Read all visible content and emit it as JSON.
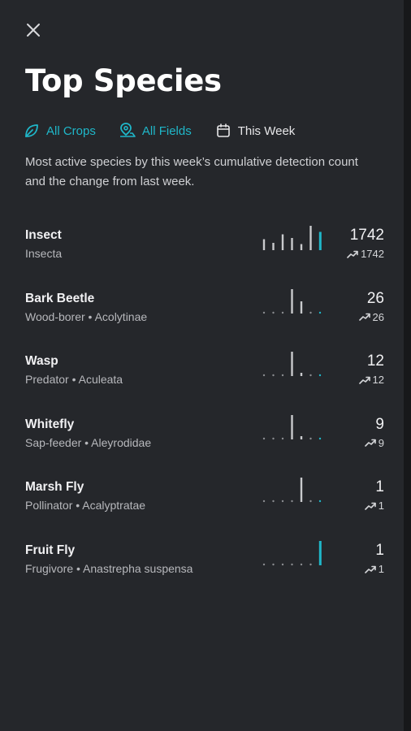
{
  "header": {
    "close_icon": "close-icon",
    "title": "Top Species"
  },
  "filters": [
    {
      "label": "All Crops",
      "icon": "leaf-icon",
      "color": "#1fb7c9"
    },
    {
      "label": "All Fields",
      "icon": "map-pin-icon",
      "color": "#1fb7c9"
    },
    {
      "label": "This Week",
      "icon": "calendar-icon",
      "color": "#e6e6e8"
    }
  ],
  "description": "Most active species by this week’s cumulative detection count and the change from last week.",
  "colors": {
    "accent": "#1fb7c9",
    "bar": "#c9cacd",
    "dot": "#8a8c90",
    "background": "#25272b"
  },
  "species": [
    {
      "name": "Insect",
      "sub": "Insecta",
      "count": "1742",
      "delta": "1742",
      "trend": [
        0.45,
        0.3,
        0.65,
        0.5,
        0.25,
        1.0,
        0.75
      ]
    },
    {
      "name": "Bark Beetle",
      "sub": "Wood-borer • Acolytinae",
      "count": "26",
      "delta": "26",
      "trend": [
        0,
        0,
        0,
        1.0,
        0.5,
        0,
        0
      ]
    },
    {
      "name": "Wasp",
      "sub": "Predator • Aculeata",
      "count": "12",
      "delta": "12",
      "trend": [
        0,
        0,
        0,
        1.0,
        0.12,
        0,
        0
      ]
    },
    {
      "name": "Whitefly",
      "sub": "Sap-feeder • Aleyrodidae",
      "count": "9",
      "delta": "9",
      "trend": [
        0,
        0,
        0,
        1.0,
        0.12,
        0,
        0
      ]
    },
    {
      "name": "Marsh Fly",
      "sub": "Pollinator • Acalyptratae",
      "count": "1",
      "delta": "1",
      "trend": [
        0,
        0,
        0,
        0,
        1.0,
        0,
        0
      ]
    },
    {
      "name": "Fruit Fly",
      "sub": "Frugivore • Anastrepha suspensa",
      "count": "1",
      "delta": "1",
      "trend": [
        0,
        0,
        0,
        0,
        0,
        0,
        1.0
      ]
    }
  ]
}
